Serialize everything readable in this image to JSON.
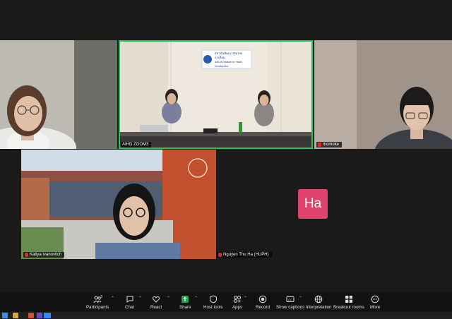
{
  "participants": [
    {
      "name": "",
      "label": "participant-top-left"
    },
    {
      "name": "AIHD ZOOM3",
      "active": true
    },
    {
      "name": "momoke"
    },
    {
      "name": "Katiya Ivanovitch"
    },
    {
      "name": "Nguyen Thu Ha (HUPH)",
      "avatar_initials": "Ha"
    }
  ],
  "banner": {
    "title": "สถาบันพัฒนาสุขภาพอาเซียน",
    "subtitle": "ASEAN Institute for Health Development"
  },
  "toolbar": {
    "participants_count": "3",
    "items": [
      {
        "label": "Participants",
        "icon": "people-icon"
      },
      {
        "label": "Chat",
        "icon": "chat-icon"
      },
      {
        "label": "React",
        "icon": "heart-icon"
      },
      {
        "label": "Share",
        "icon": "share-icon"
      },
      {
        "label": "Host tools",
        "icon": "shield-icon"
      },
      {
        "label": "Apps",
        "icon": "apps-icon"
      },
      {
        "label": "Record",
        "icon": "record-icon"
      },
      {
        "label": "Show captions",
        "icon": "cc-icon"
      },
      {
        "label": "Interpretation",
        "icon": "globe-icon"
      },
      {
        "label": "Breakout rooms",
        "icon": "grid-icon"
      },
      {
        "label": "More",
        "icon": "more-icon"
      }
    ]
  },
  "colors": {
    "active_speaker": "#25c35a",
    "avatar_bg": "#e0436b",
    "share_green": "#1fa34a",
    "record_red": "#e02828"
  }
}
